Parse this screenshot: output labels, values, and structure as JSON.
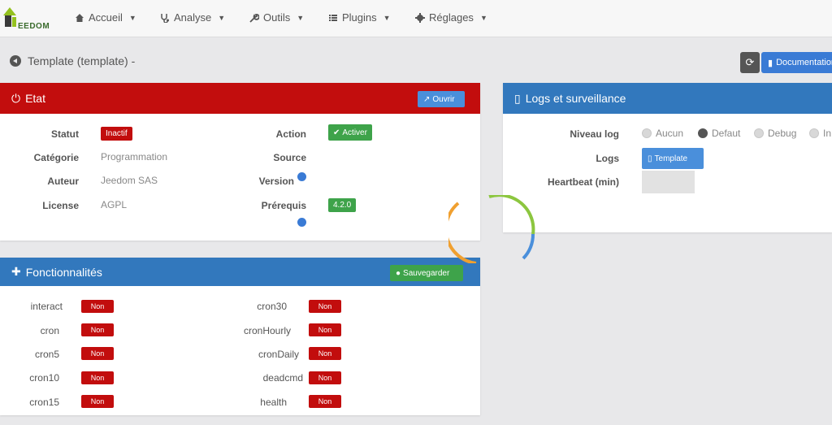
{
  "navbar": {
    "logo_text": "EEDOM",
    "items": [
      {
        "label": "Accueil",
        "icon": "home-icon"
      },
      {
        "label": "Analyse",
        "icon": "stethoscope-icon"
      },
      {
        "label": "Outils",
        "icon": "wrench-icon"
      },
      {
        "label": "Plugins",
        "icon": "list-icon"
      },
      {
        "label": "Réglages",
        "icon": "gear-icon"
      }
    ]
  },
  "page": {
    "title": "Template (template) -",
    "doc_label": "Documentation"
  },
  "etat": {
    "title": "Etat",
    "open_label": "Ouvrir",
    "rows": {
      "statut_label": "Statut",
      "statut_value": "Inactif",
      "categorie_label": "Catégorie",
      "categorie_value": "Programmation",
      "auteur_label": "Auteur",
      "auteur_value": "Jeedom SAS",
      "license_label": "License",
      "license_value": "AGPL",
      "action_label": "Action",
      "action_value": "Activer",
      "source_label": "Source",
      "version_label": "Version",
      "prerequis_label": "Prérequis",
      "prerequis_value": "4.2.0"
    },
    "colors": {
      "accent": "#c20d0d"
    }
  },
  "logs": {
    "title": "Logs et surveillance",
    "niveau_label": "Niveau log",
    "options": [
      "Aucun",
      "Defaut",
      "Debug",
      "In"
    ],
    "selected": "Defaut",
    "logs_label": "Logs",
    "logs_button": "Template",
    "heartbeat_label": "Heartbeat (min)",
    "heartbeat_value": ""
  },
  "features": {
    "title": "Fonctionnalités",
    "save_label": "Sauvegarder",
    "left": [
      {
        "name": "interact",
        "value": "Non"
      },
      {
        "name": "cron",
        "value": "Non"
      },
      {
        "name": "cron5",
        "value": "Non"
      },
      {
        "name": "cron10",
        "value": "Non"
      },
      {
        "name": "cron15",
        "value": "Non"
      }
    ],
    "right": [
      {
        "name": "cron30",
        "value": "Non"
      },
      {
        "name": "cronHourly",
        "value": "Non"
      },
      {
        "name": "cronDaily",
        "value": "Non"
      },
      {
        "name": "deadcmd",
        "value": "Non"
      },
      {
        "name": "health",
        "value": "Non"
      }
    ]
  }
}
